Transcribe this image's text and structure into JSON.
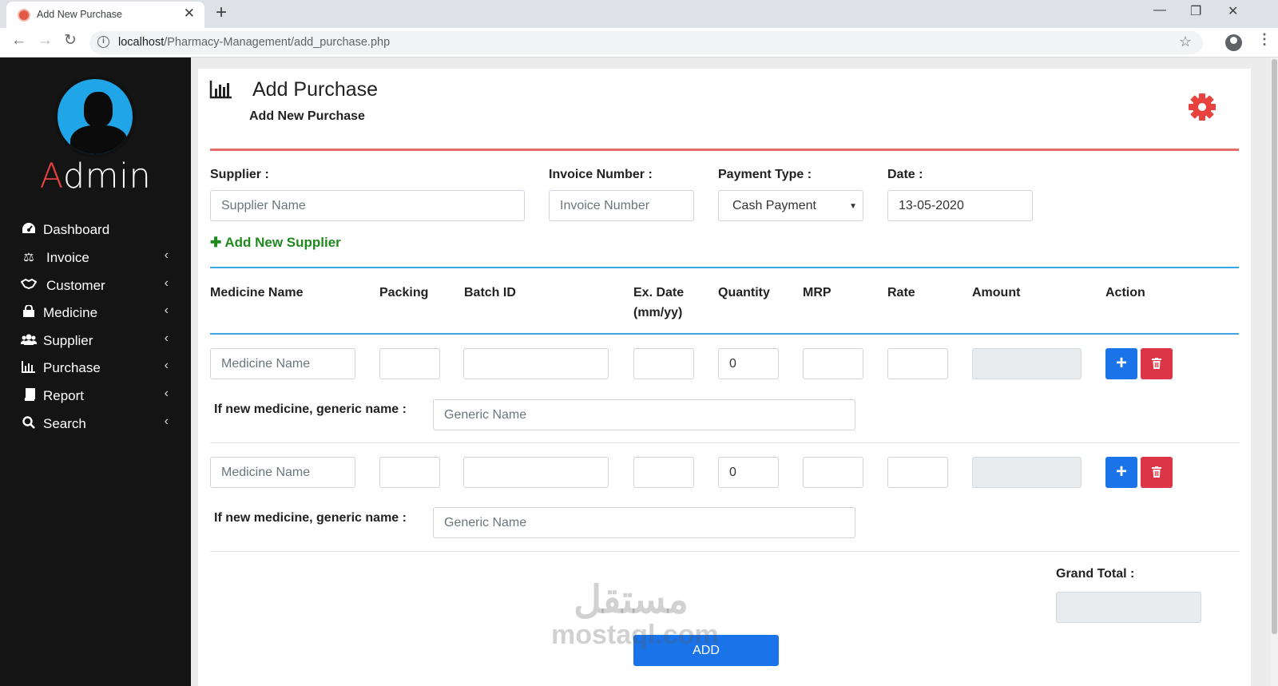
{
  "browser": {
    "tab_title": "Add New Purchase",
    "url_host": "localhost",
    "url_path": "/Pharmacy-Management/add_purchase.php"
  },
  "sidebar": {
    "brand_first": "A",
    "brand_rest": "dmin",
    "items": [
      {
        "label": "Dashboard",
        "icon": "dashboard-icon",
        "chevron": false
      },
      {
        "label": "Invoice",
        "icon": "balance-scale-icon",
        "chevron": true
      },
      {
        "label": "Customer",
        "icon": "handshake-icon",
        "chevron": true
      },
      {
        "label": "Medicine",
        "icon": "shopping-bag-icon",
        "chevron": true
      },
      {
        "label": "Supplier",
        "icon": "users-icon",
        "chevron": true
      },
      {
        "label": "Purchase",
        "icon": "bar-chart-icon",
        "chevron": true
      },
      {
        "label": "Report",
        "icon": "book-icon",
        "chevron": true
      },
      {
        "label": "Search",
        "icon": "search-icon",
        "chevron": true
      }
    ]
  },
  "header": {
    "title": "Add Purchase",
    "subtitle": "Add New Purchase"
  },
  "form": {
    "supplier_label": "Supplier :",
    "supplier_placeholder": "Supplier Name",
    "invoice_label": "Invoice Number :",
    "invoice_placeholder": "Invoice Number",
    "payment_label": "Payment Type :",
    "payment_value": "Cash Payment",
    "date_label": "Date :",
    "date_value": "13-05-2020",
    "add_supplier": "Add New Supplier"
  },
  "table": {
    "headers": {
      "medicine": "Medicine Name",
      "packing": "Packing",
      "batch": "Batch ID",
      "exdate_1": "Ex. Date",
      "exdate_2": "(mm/yy)",
      "quantity": "Quantity",
      "mrp": "MRP",
      "rate": "Rate",
      "amount": "Amount",
      "action": "Action"
    },
    "rows": [
      {
        "medicine_placeholder": "Medicine Name",
        "quantity": "0",
        "generic_label": "If new medicine, generic name :",
        "generic_placeholder": "Generic Name"
      },
      {
        "medicine_placeholder": "Medicine Name",
        "quantity": "0",
        "generic_label": "If new medicine, generic name :",
        "generic_placeholder": "Generic Name"
      }
    ]
  },
  "footer": {
    "grand_total_label": "Grand Total :",
    "add_button": "ADD",
    "watermark_ar": "مستقل",
    "watermark_en": "mostaql.com"
  },
  "colors": {
    "sidebar_bg": "#141414",
    "accent_red": "#e8423f",
    "primary_blue": "#1a73e8",
    "danger_red": "#dc3545",
    "success_green": "#1e8a1e"
  }
}
